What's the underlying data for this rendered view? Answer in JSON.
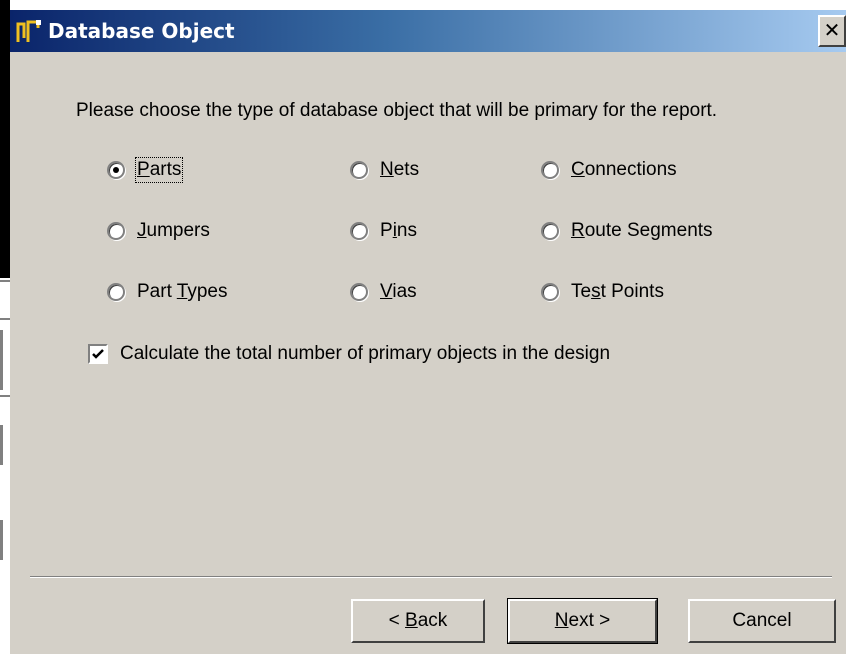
{
  "dialog": {
    "title": "Database Object",
    "close_glyph": "✕"
  },
  "prompt": "Please choose the type of database object that will be primary for the report.",
  "object_types": {
    "selected": "Parts",
    "parts": {
      "label": "Parts",
      "accel": "P"
    },
    "nets": {
      "label": "Nets",
      "accel": "N"
    },
    "connections": {
      "label": "Connections",
      "accel": "C"
    },
    "jumpers": {
      "label": "Jumpers",
      "accel": "J"
    },
    "pins": {
      "label": "Pins",
      "accel": "i"
    },
    "route_segments": {
      "label": "Route Segments",
      "accel": "R"
    },
    "part_types": {
      "label": "Part Types",
      "accel": "T"
    },
    "vias": {
      "label": "Vias",
      "accel": "V"
    },
    "test_points": {
      "label": "Test Points",
      "accel": "s"
    }
  },
  "calc_total": {
    "label": "Calculate the total number of primary objects in the design",
    "checked": true
  },
  "buttons": {
    "back": "< Back",
    "next": "Next >",
    "cancel": "Cancel"
  },
  "colors": {
    "face": "#d4d0c8",
    "title_gradient_start": "#0a246a",
    "title_gradient_end": "#a6caf0"
  }
}
